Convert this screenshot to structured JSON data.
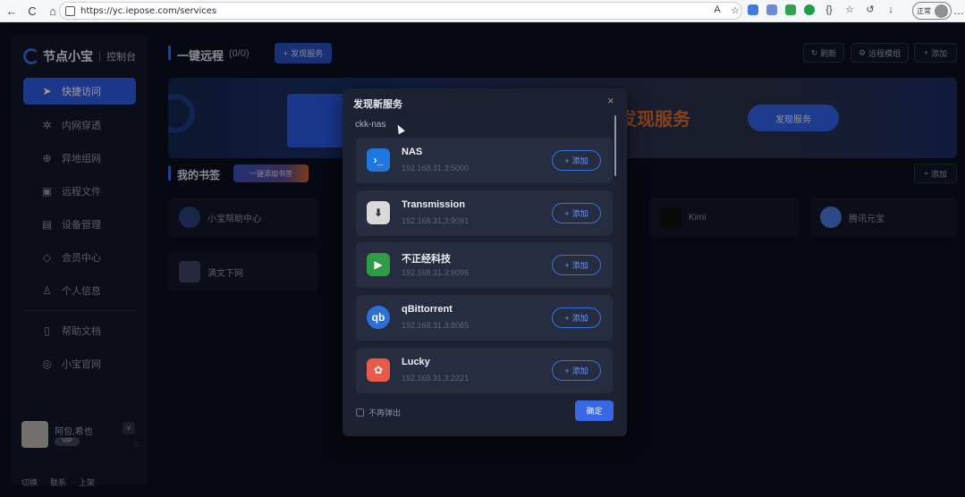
{
  "browser": {
    "url": "https://yc.iepose.com/services",
    "nav_back": "←",
    "nav_reload": "C",
    "nav_home": "⌂",
    "profile_label": "正常",
    "menu": "…"
  },
  "sidebar": {
    "brand": "节点小宝",
    "brand_sub": "控制台",
    "items": [
      {
        "label": "快捷访问",
        "icon": "send-icon"
      },
      {
        "label": "内网穿透",
        "icon": "network-icon"
      },
      {
        "label": "异地组网",
        "icon": "globe-icon"
      },
      {
        "label": "远程文件",
        "icon": "folder-icon"
      },
      {
        "label": "设备管理",
        "icon": "device-icon"
      },
      {
        "label": "会员中心",
        "icon": "diamond-icon"
      },
      {
        "label": "个人信息",
        "icon": "user-icon"
      },
      {
        "label": "帮助文档",
        "icon": "doc-icon"
      },
      {
        "label": "小宝官网",
        "icon": "compass-icon"
      }
    ],
    "user_name": "阿包,希也",
    "user_badge": "VIP",
    "footer": [
      "切换",
      "联系",
      "上架"
    ]
  },
  "main": {
    "title": "一键远程",
    "count": "(0/0)",
    "discover_button": "发现服务",
    "refresh": "刷新",
    "remote_module": "远程模组",
    "add": "添加",
    "banner_text": "发现服务",
    "banner_button": "发现服务",
    "bookmarks_title": "我的书签",
    "bookmarks_button": "一键添加书签",
    "bookmarks_add": "添加",
    "bookmarks": [
      {
        "label": "小宝帮助中心"
      },
      {
        "label": "Kimi"
      },
      {
        "label": "腾讯元宝"
      },
      {
        "label": "满文下网"
      }
    ]
  },
  "modal": {
    "title": "发现新服务",
    "close": "×",
    "device": "ckk-nas",
    "services": [
      {
        "name": "NAS",
        "addr": "192.168.31.3:5000",
        "icon_color": "#1f78e0",
        "icon_glyph": "›_"
      },
      {
        "name": "Transmission",
        "addr": "192.168.31.3:9091",
        "icon_color": "#d9d9d9",
        "icon_glyph": "⬇"
      },
      {
        "name": "不正经科技",
        "addr": "192.168.31.3:6096",
        "icon_color": "#2e9b45",
        "icon_glyph": "▶"
      },
      {
        "name": "qBittorrent",
        "addr": "192.168.31.3:8085",
        "icon_color": "#2c6fd6",
        "icon_glyph": "qb"
      },
      {
        "name": "Lucky",
        "addr": "192.168.31.3:2221",
        "icon_color": "#e95a4a",
        "icon_glyph": "✿"
      }
    ],
    "add_label": "添加",
    "no_popup": "不再弹出",
    "confirm": "确定"
  }
}
